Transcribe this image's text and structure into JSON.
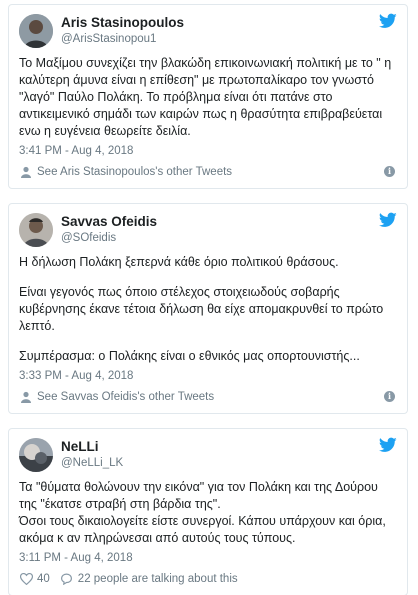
{
  "accent_color": "#1da1f2",
  "tweets": [
    {
      "display_name": "Aris Stasinopoulos",
      "handle": "@ArisStasinopou1",
      "paragraphs": [
        "Το Μαξίμου συνεχίζει την βλακώδη επικοινωνιακή πολιτική με το \" η καλύτερη άμυνα είναι η επίθεση\" με πρωτοπαλίκαρο τον γνωστό \"λαγό\" Παύλο Πολάκη. Το πρόβλημα είναι ότι πατάνε στο αντικειμενικό σημάδι των καιρών πως η θρασύτητα επιβραβεύεται ενω η ευγένεια θεωρείτε δειλία."
      ],
      "timestamp": "3:41 PM - Aug 4, 2018",
      "footer_text": "See Aris Stasinopoulos's other Tweets"
    },
    {
      "display_name": "Savvas Ofeidis",
      "handle": "@SOfeidis",
      "paragraphs": [
        "Η δήλωση Πολάκη ξεπερνά κάθε όριο πολιτικού θράσους.",
        "Είναι γεγονός πως όποιο στέλεχος στοιχειωδούς σοβαρής κυβέρνησης έκανε τέτοια δήλωση θα είχε απομακρυνθεί το πρώτο λεπτό.",
        "Συμπέρασμα: ο Πολάκης είναι ο εθνικός μας οπορτουνιστής..."
      ],
      "timestamp": "3:33 PM - Aug 4, 2018",
      "footer_text": "See Savvas Ofeidis's other Tweets"
    },
    {
      "display_name": "NeLLi",
      "handle": "@NeLLi_LK",
      "paragraphs": [
        "Τα \"θύματα θολώνουν την εικόνα\" για τον Πολάκη και της Δούρου της \"έκατσε στραβή στη βάρδια της\".\nΌσοι τους δικαιολογείτε είστε συνεργοί. Κάπου υπάρχουν και όρια, ακόμα κ αν πληρώνεσαι από αυτούς τους τύπους."
      ],
      "timestamp": "3:11 PM - Aug 4, 2018",
      "likes": "40",
      "talking_text": "22 people are talking about this"
    }
  ]
}
